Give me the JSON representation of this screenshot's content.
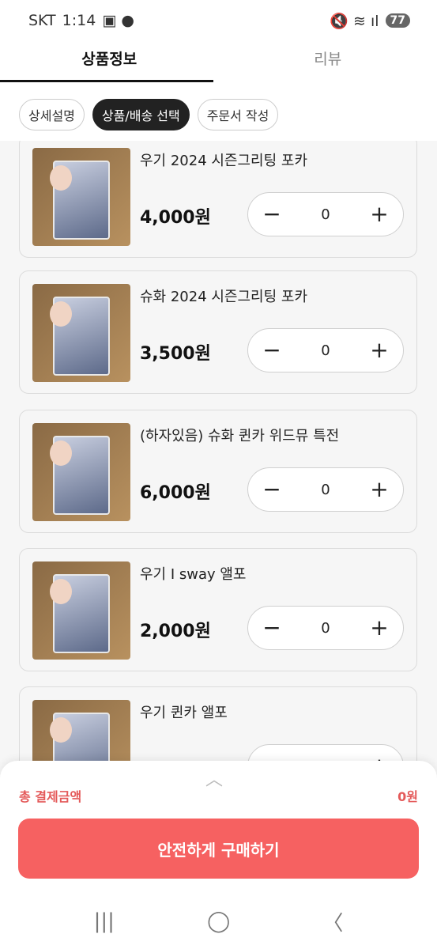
{
  "status": {
    "carrier": "SKT",
    "time": "1:14",
    "left_icons": "▣ ●",
    "right_icons": "🔇 ≋ ıl",
    "battery": "77"
  },
  "tabs": [
    {
      "label": "상품정보",
      "active": true
    },
    {
      "label": "리뷰",
      "active": false
    }
  ],
  "chips": [
    {
      "label": "상세설명",
      "active": false
    },
    {
      "label": "상품/배송 선택",
      "active": true
    },
    {
      "label": "주문서 작성",
      "active": false
    }
  ],
  "products": [
    {
      "title": "우기 2024 시즌그리팅 포카",
      "price": "4,000원",
      "qty": "0"
    },
    {
      "title": "슈화 2024 시즌그리팅 포카",
      "price": "3,500원",
      "qty": "0"
    },
    {
      "title": "(하자있음) 슈화 퀸카 위드뮤 특전",
      "price": "6,000원",
      "qty": "0"
    },
    {
      "title": "우기 I sway 앨포",
      "price": "2,000원",
      "qty": "0"
    },
    {
      "title": "우기 퀸카 앨포",
      "price": "",
      "qty": ""
    }
  ],
  "stepper": {
    "minus": "−",
    "plus": "+"
  },
  "bottom": {
    "handle": "︿",
    "total_label": "총 결제금액",
    "total_value": "0원",
    "buy_label": "안전하게 구매하기"
  },
  "nav": {
    "recent": "|||",
    "home": "◯",
    "back": "〈"
  },
  "colors": {
    "accent": "#f66161",
    "total": "#e45a5a"
  }
}
